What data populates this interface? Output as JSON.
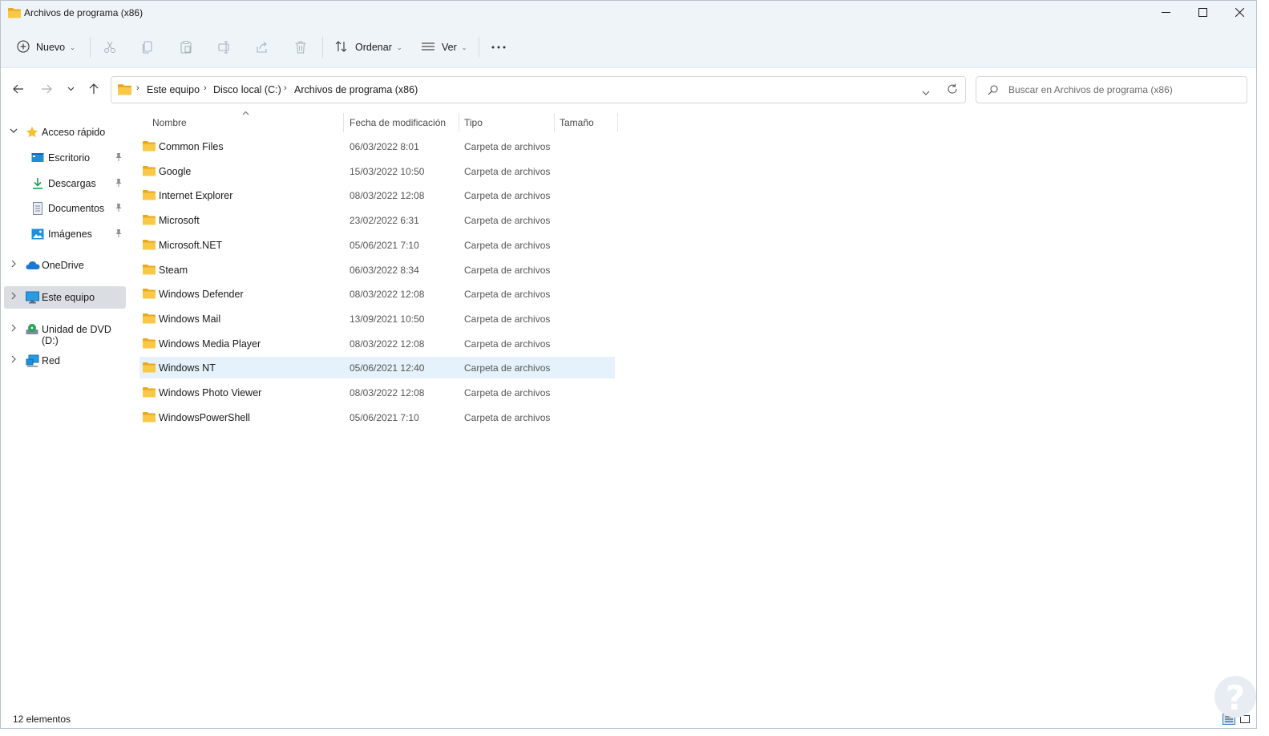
{
  "window": {
    "title": "Archivos de programa (x86)"
  },
  "toolbar": {
    "new_label": "Nuevo",
    "sort_label": "Ordenar",
    "view_label": "Ver",
    "icons": [
      "cut-icon",
      "copy-icon",
      "paste-icon",
      "rename-icon",
      "share-icon",
      "delete-icon",
      "more-icon"
    ]
  },
  "address": {
    "crumbs": [
      "Este equipo",
      "Disco local (C:)",
      "Archivos de programa (x86)"
    ]
  },
  "search": {
    "placeholder": "Buscar en Archivos de programa (x86)"
  },
  "sidebar": {
    "items": [
      {
        "label": "Acceso rápido",
        "icon": "star-icon"
      },
      {
        "label": "Escritorio",
        "icon": "desktop-icon",
        "pinned": true
      },
      {
        "label": "Descargas",
        "icon": "download-icon",
        "pinned": true
      },
      {
        "label": "Documentos",
        "icon": "documents-icon",
        "pinned": true
      },
      {
        "label": "Imágenes",
        "icon": "pictures-icon",
        "pinned": true
      },
      {
        "label": "OneDrive",
        "icon": "cloud-icon"
      },
      {
        "label": "Este equipo",
        "icon": "computer-icon",
        "selected": true
      },
      {
        "label": "Unidad de DVD (D:)",
        "icon": "dvd-drive-icon"
      },
      {
        "label": "Red",
        "icon": "network-icon"
      }
    ]
  },
  "columns": {
    "name": "Nombre",
    "date": "Fecha de modificación",
    "type": "Tipo",
    "size": "Tamaño"
  },
  "files": [
    {
      "name": "Common Files",
      "date": "06/03/2022 8:01",
      "type": "Carpeta de archivos"
    },
    {
      "name": "Google",
      "date": "15/03/2022 10:50",
      "type": "Carpeta de archivos"
    },
    {
      "name": "Internet Explorer",
      "date": "08/03/2022 12:08",
      "type": "Carpeta de archivos"
    },
    {
      "name": "Microsoft",
      "date": "23/02/2022 6:31",
      "type": "Carpeta de archivos"
    },
    {
      "name": "Microsoft.NET",
      "date": "05/06/2021 7:10",
      "type": "Carpeta de archivos"
    },
    {
      "name": "Steam",
      "date": "06/03/2022 8:34",
      "type": "Carpeta de archivos"
    },
    {
      "name": "Windows Defender",
      "date": "08/03/2022 12:08",
      "type": "Carpeta de archivos"
    },
    {
      "name": "Windows Mail",
      "date": "13/09/2021 10:50",
      "type": "Carpeta de archivos"
    },
    {
      "name": "Windows Media Player",
      "date": "08/03/2022 12:08",
      "type": "Carpeta de archivos"
    },
    {
      "name": "Windows NT",
      "date": "05/06/2021 12:40",
      "type": "Carpeta de archivos",
      "selected": true
    },
    {
      "name": "Windows Photo Viewer",
      "date": "08/03/2022 12:08",
      "type": "Carpeta de archivos"
    },
    {
      "name": "WindowsPowerShell",
      "date": "05/06/2021 7:10",
      "type": "Carpeta de archivos"
    }
  ],
  "status": {
    "count": "12 elementos"
  },
  "colors": {
    "chrome_bg": "#eff4f9",
    "selected_row": "#e5f1fb",
    "selected_nav": "#dadde1",
    "folder_yellow": "#f8c846"
  }
}
